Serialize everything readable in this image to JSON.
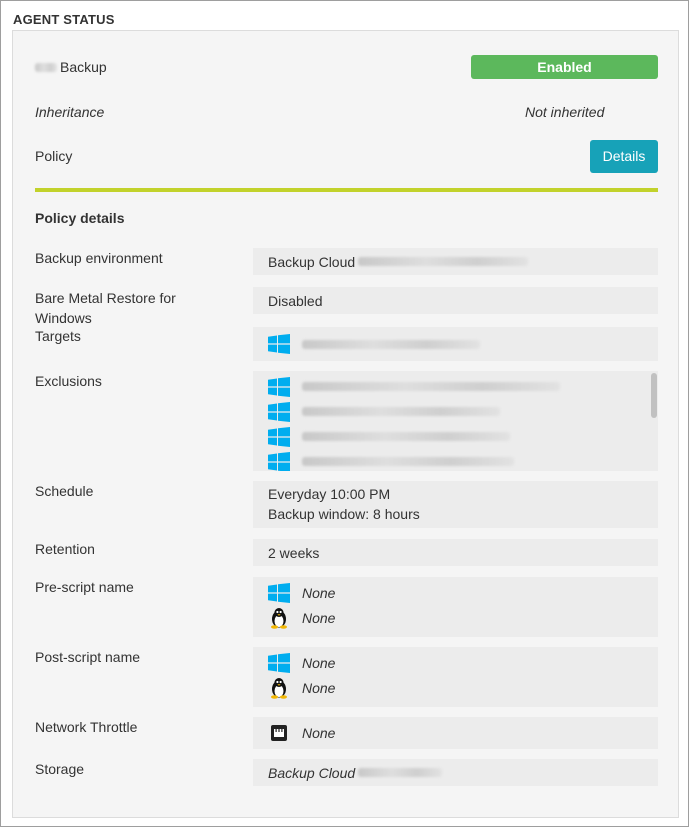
{
  "panel": {
    "title": "AGENT STATUS"
  },
  "backup": {
    "label": "Backup",
    "status": "Enabled"
  },
  "inheritance": {
    "label": "Inheritance",
    "value": "Not inherited"
  },
  "policy": {
    "label": "Policy",
    "button": "Details"
  },
  "policy_details": {
    "heading": "Policy details",
    "backup_environment": {
      "label": "Backup environment",
      "value": "Backup Cloud"
    },
    "bare_metal": {
      "label": "Bare Metal Restore for Windows",
      "value": "Disabled"
    },
    "targets": {
      "label": "Targets",
      "icons": [
        "windows-icon"
      ]
    },
    "exclusions": {
      "label": "Exclusions",
      "icons": [
        "windows-icon",
        "windows-icon",
        "windows-icon",
        "windows-icon"
      ]
    },
    "schedule": {
      "label": "Schedule",
      "line1": "Everyday 10:00 PM",
      "line2": "Backup window: 8 hours"
    },
    "retention": {
      "label": "Retention",
      "value": "2 weeks"
    },
    "pre_script": {
      "label": "Pre-script name",
      "windows": "None",
      "linux": "None"
    },
    "post_script": {
      "label": "Post-script name",
      "windows": "None",
      "linux": "None"
    },
    "network_throttle": {
      "label": "Network Throttle",
      "value": "None"
    },
    "storage": {
      "label": "Storage",
      "value": "Backup Cloud"
    }
  },
  "colors": {
    "enabled": "#5cb85c",
    "details_button": "#17a2b8",
    "divider": "#c2d22b",
    "windows": "#00adef"
  }
}
